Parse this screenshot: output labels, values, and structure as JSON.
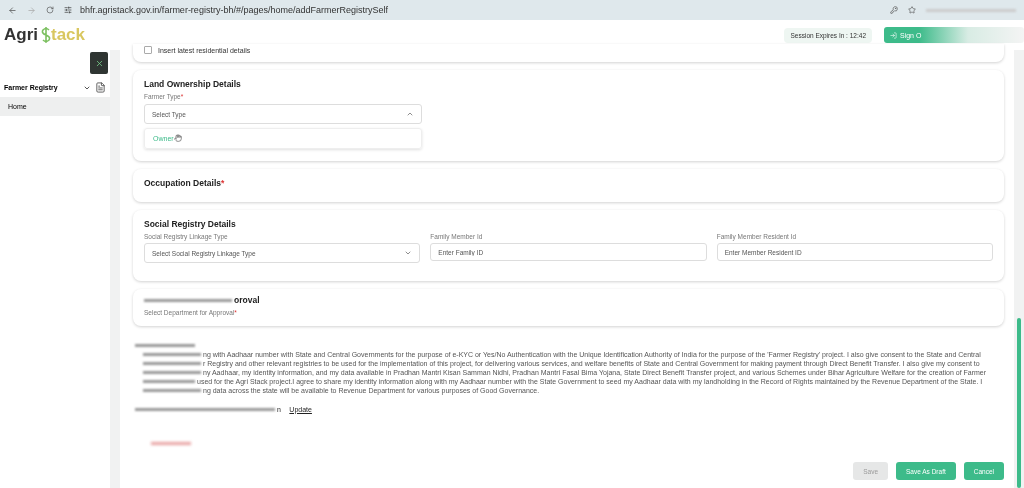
{
  "browser": {
    "url": "bhfr.agristack.gov.in/farmer-registry-bh/#/pages/home/addFarmerRegistrySelf"
  },
  "header": {
    "logo": {
      "part_1": "Agri",
      "part_2": "tack"
    },
    "session": "Session Expires In : 12:42",
    "sign_out": "Sign O"
  },
  "sidebar": {
    "section": "Farmer Registry",
    "expanded": true,
    "items": [
      {
        "label": "Home",
        "selected": true
      }
    ]
  },
  "residential": {
    "label": "Insert latest residential details",
    "checked": false
  },
  "land": {
    "title": "Land Ownership Details",
    "field_label": "Farmer Type",
    "required_mark": "*",
    "placeholder": "Select Type",
    "expanded": true,
    "options": [
      {
        "label": "Owner",
        "highlighted": true
      }
    ]
  },
  "occupation": {
    "title": "Occupation Details",
    "required_mark": "*"
  },
  "social": {
    "title": "Social Registry Details",
    "fields": [
      {
        "kind": "select",
        "label": "Social Registry Linkage Type",
        "placeholder": "Select Social Registry Linkage Type"
      },
      {
        "kind": "input",
        "label": "Family Member Id",
        "placeholder": "Enter Family ID"
      },
      {
        "kind": "input",
        "label": "Family Member Resident Id",
        "placeholder": "Enter Member Resident ID"
      }
    ]
  },
  "approval": {
    "title": "oroval",
    "field_label": "Select Department for Approval",
    "required_mark": "*"
  },
  "consent": {
    "lines": [
      "ng with Aadhaar number with State and Central Governments for the purpose of e-KYC or Yes/No Authentication with the Unique Identification Authority of India for the purpose of the 'Farmer Registry' project. I also give consent to the State and Central",
      "r Registry and other relevant registries to be used for the implementation of this project, for delivering various services, and welfare benefits of State and Central Government for making payment through Direct Benefit Transfer. I also give my consent to",
      "ny Aadhaar, my identity information, and my data available in Pradhan Mantri Kisan Samman Nidhi, Pradhan Mantri Fasal Bima Yojana, State Direct Benefit Transfer project, and various Schemes under Bihar Agriculture Welfare for the creation of Farmer",
      "used for the Agri Stack project.I agree to share my identity information along with my Aadhaar number with the State Government to seed my Aadhaar data with my landholding in the Record of Rights maintained by the Revenue Department of the State. I",
      "ng data across the state will be available to Revenue Department for various purposes of Good Governance."
    ],
    "update_prefix": "n",
    "update_link": "Update"
  },
  "buttons": [
    {
      "label": "Save",
      "kind": "plain",
      "disabled": true
    },
    {
      "label": "Save As Draft",
      "kind": "primary",
      "disabled": false
    },
    {
      "label": "Cancel",
      "kind": "primary",
      "disabled": false
    }
  ]
}
